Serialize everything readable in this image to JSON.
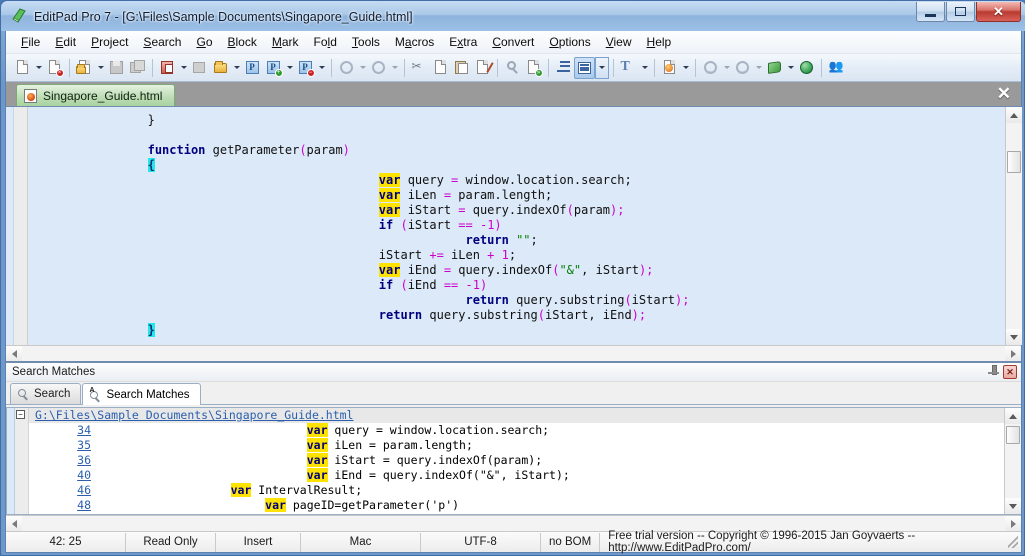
{
  "window": {
    "title": "EditPad Pro 7 - [G:\\Files\\Sample Documents\\Singapore_Guide.html]",
    "icon": "editpad-logo-icon",
    "minimize_label": "",
    "maximize_label": "",
    "close_label": "✕"
  },
  "menu": {
    "items": [
      {
        "label": "File",
        "accel": "F"
      },
      {
        "label": "Edit",
        "accel": "E"
      },
      {
        "label": "Project",
        "accel": "P"
      },
      {
        "label": "Search",
        "accel": "S"
      },
      {
        "label": "Go",
        "accel": "G"
      },
      {
        "label": "Block",
        "accel": "B"
      },
      {
        "label": "Mark",
        "accel": "M"
      },
      {
        "label": "Fold",
        "accel": "l"
      },
      {
        "label": "Tools",
        "accel": "T"
      },
      {
        "label": "Macros",
        "accel": "a"
      },
      {
        "label": "Extra",
        "accel": "x"
      },
      {
        "label": "Convert",
        "accel": "C"
      },
      {
        "label": "Options",
        "accel": "O"
      },
      {
        "label": "View",
        "accel": "V"
      },
      {
        "label": "Help",
        "accel": "H"
      }
    ]
  },
  "toolbar": {
    "buttons": [
      {
        "name": "new-file",
        "icon": "new-page-icon",
        "dropdown": true,
        "enabled": true
      },
      {
        "name": "close-file",
        "icon": "page-close-icon",
        "dropdown": false,
        "enabled": true
      },
      {
        "name": "open-file",
        "icon": "open-folder-icon",
        "dropdown": true,
        "enabled": true
      },
      {
        "name": "save-file",
        "icon": "floppy-save-icon",
        "dropdown": false,
        "enabled": false
      },
      {
        "name": "save-all",
        "icon": "save-all-icon",
        "dropdown": false,
        "enabled": false
      },
      {
        "name": "close-project",
        "icon": "project-close-icon",
        "dropdown": true,
        "enabled": true
      },
      {
        "name": "save-project",
        "icon": "project-save-icon",
        "dropdown": false,
        "enabled": false
      },
      {
        "name": "open-project",
        "icon": "project-folder-icon",
        "dropdown": true,
        "enabled": true
      },
      {
        "name": "project-p",
        "icon": "project-p-icon",
        "dropdown": false,
        "enabled": true
      },
      {
        "name": "project-add",
        "icon": "project-p-add-icon",
        "dropdown": true,
        "enabled": true
      },
      {
        "name": "project-remove",
        "icon": "project-p-remove-icon",
        "dropdown": true,
        "enabled": true
      },
      {
        "name": "undo",
        "icon": "undo-icon",
        "dropdown": true,
        "enabled": false
      },
      {
        "name": "redo",
        "icon": "redo-icon",
        "dropdown": true,
        "enabled": false
      },
      {
        "name": "cut",
        "icon": "scissors-icon",
        "dropdown": false,
        "enabled": true
      },
      {
        "name": "copy",
        "icon": "copy-icon",
        "dropdown": false,
        "enabled": true
      },
      {
        "name": "paste",
        "icon": "clipboard-paste-icon",
        "dropdown": false,
        "enabled": true
      },
      {
        "name": "edit-clipboard",
        "icon": "pencil-page-icon",
        "dropdown": false,
        "enabled": true
      },
      {
        "name": "find",
        "icon": "magnifier-icon",
        "dropdown": false,
        "enabled": false
      },
      {
        "name": "find-next",
        "icon": "page-find-icon",
        "dropdown": false,
        "enabled": true
      },
      {
        "name": "indent",
        "icon": "indent-icon",
        "dropdown": false,
        "enabled": true
      },
      {
        "name": "word-wrap",
        "icon": "word-wrap-icon",
        "dropdown": true,
        "enabled": true,
        "pressed": true
      },
      {
        "name": "font",
        "icon": "text-font-icon",
        "dropdown": true,
        "enabled": false
      },
      {
        "name": "preview-browser",
        "icon": "browser-page-icon",
        "dropdown": true,
        "enabled": true
      },
      {
        "name": "back",
        "icon": "back-arrow-icon",
        "dropdown": true,
        "enabled": false
      },
      {
        "name": "forward",
        "icon": "forward-arrow-icon",
        "dropdown": true,
        "enabled": false
      },
      {
        "name": "book",
        "icon": "green-book-icon",
        "dropdown": true,
        "enabled": true
      },
      {
        "name": "web",
        "icon": "globe-icon",
        "dropdown": false,
        "enabled": true
      },
      {
        "name": "users",
        "icon": "people-icon",
        "dropdown": false,
        "enabled": true
      }
    ]
  },
  "file_tabs": {
    "tabs": [
      {
        "label": "Singapore_Guide.html",
        "icon": "html-file-icon",
        "active": true
      }
    ],
    "close_label": "✕"
  },
  "editor": {
    "lines": [
      {
        "indent": 4,
        "tokens": [
          {
            "t": "}",
            "c": "plain"
          }
        ]
      },
      {
        "indent": 0,
        "tokens": []
      },
      {
        "indent": 4,
        "tokens": [
          {
            "t": "function",
            "c": "kw"
          },
          {
            "t": " getParameter",
            "c": "plain"
          },
          {
            "t": "(",
            "c": "op"
          },
          {
            "t": "param",
            "c": "plain"
          },
          {
            "t": ")",
            "c": "op"
          }
        ]
      },
      {
        "indent": 4,
        "tokens": [
          {
            "t": "{",
            "c": "brc-sel"
          }
        ]
      },
      {
        "indent": 12,
        "tokens": [
          {
            "t": "var",
            "c": "kwv"
          },
          {
            "t": " query ",
            "c": "plain"
          },
          {
            "t": "=",
            "c": "op"
          },
          {
            "t": " window.location.search;",
            "c": "plain"
          }
        ]
      },
      {
        "indent": 12,
        "tokens": [
          {
            "t": "var",
            "c": "kwv"
          },
          {
            "t": " iLen ",
            "c": "plain"
          },
          {
            "t": "=",
            "c": "op"
          },
          {
            "t": " param.length;",
            "c": "plain"
          }
        ]
      },
      {
        "indent": 12,
        "tokens": [
          {
            "t": "var",
            "c": "kwv"
          },
          {
            "t": " iStart ",
            "c": "plain"
          },
          {
            "t": "=",
            "c": "op"
          },
          {
            "t": " query.indexOf",
            "c": "plain"
          },
          {
            "t": "(",
            "c": "op"
          },
          {
            "t": "param",
            "c": "plain"
          },
          {
            "t": ");",
            "c": "op"
          }
        ]
      },
      {
        "indent": 12,
        "tokens": [
          {
            "t": "if",
            "c": "kw"
          },
          {
            "t": " ",
            "c": "plain"
          },
          {
            "t": "(",
            "c": "op"
          },
          {
            "t": "iStart ",
            "c": "plain"
          },
          {
            "t": "==",
            "c": "op"
          },
          {
            "t": " ",
            "c": "plain"
          },
          {
            "t": "-1",
            "c": "num"
          },
          {
            "t": ")",
            "c": "op"
          }
        ]
      },
      {
        "indent": 15,
        "tokens": [
          {
            "t": "return",
            "c": "kw"
          },
          {
            "t": " ",
            "c": "plain"
          },
          {
            "t": "\"\"",
            "c": "str"
          },
          {
            "t": ";",
            "c": "plain"
          }
        ]
      },
      {
        "indent": 12,
        "tokens": [
          {
            "t": "iStart ",
            "c": "plain"
          },
          {
            "t": "+=",
            "c": "op"
          },
          {
            "t": " iLen ",
            "c": "plain"
          },
          {
            "t": "+",
            "c": "op"
          },
          {
            "t": " ",
            "c": "plain"
          },
          {
            "t": "1",
            "c": "num"
          },
          {
            "t": ";",
            "c": "plain"
          }
        ]
      },
      {
        "indent": 12,
        "tokens": [
          {
            "t": "var",
            "c": "kwv"
          },
          {
            "t": " iEnd ",
            "c": "plain"
          },
          {
            "t": "=",
            "c": "op"
          },
          {
            "t": " query.indexOf",
            "c": "plain"
          },
          {
            "t": "(",
            "c": "op"
          },
          {
            "t": "\"&\"",
            "c": "str"
          },
          {
            "t": ", iStart",
            "c": "plain"
          },
          {
            "t": ");",
            "c": "op"
          }
        ]
      },
      {
        "indent": 12,
        "tokens": [
          {
            "t": "if",
            "c": "kw"
          },
          {
            "t": " ",
            "c": "plain"
          },
          {
            "t": "(",
            "c": "op"
          },
          {
            "t": "iEnd ",
            "c": "plain"
          },
          {
            "t": "==",
            "c": "op"
          },
          {
            "t": " ",
            "c": "plain"
          },
          {
            "t": "-1",
            "c": "num"
          },
          {
            "t": ")",
            "c": "op"
          }
        ]
      },
      {
        "indent": 15,
        "tokens": [
          {
            "t": "return",
            "c": "kw"
          },
          {
            "t": " query.substring",
            "c": "plain"
          },
          {
            "t": "(",
            "c": "op"
          },
          {
            "t": "iStart",
            "c": "plain"
          },
          {
            "t": ");",
            "c": "op"
          }
        ]
      },
      {
        "indent": 12,
        "tokens": [
          {
            "t": "return",
            "c": "kw"
          },
          {
            "t": " query.substring",
            "c": "plain"
          },
          {
            "t": "(",
            "c": "op"
          },
          {
            "t": "iStart, iEnd",
            "c": "plain"
          },
          {
            "t": ");",
            "c": "op"
          }
        ]
      },
      {
        "indent": 4,
        "tokens": [
          {
            "t": "}",
            "c": "brc-sel"
          }
        ]
      }
    ]
  },
  "panel": {
    "caption": "Search Matches",
    "pin_icon": "pin-icon",
    "close_icon": "close-icon",
    "close_label": "✕",
    "tabs": [
      {
        "label": "Search",
        "icon": "magnifier-icon",
        "active": false
      },
      {
        "label": "Search Matches",
        "icon": "magnifier-a-icon",
        "active": true
      }
    ],
    "results_header": "G:\\Files\\Sample Documents\\Singapore_Guide.html",
    "results": [
      {
        "line": "34",
        "pre": "                              ",
        "kw": "var",
        "post": " query = window.location.search;"
      },
      {
        "line": "35",
        "pre": "                              ",
        "kw": "var",
        "post": " iLen = param.length;"
      },
      {
        "line": "36",
        "pre": "                              ",
        "kw": "var",
        "post": " iStart = query.indexOf(param);"
      },
      {
        "line": "40",
        "pre": "                              ",
        "kw": "var",
        "post": " iEnd = query.indexOf(\"&\", iStart);"
      },
      {
        "line": "46",
        "pre": "                   ",
        "kw": "var",
        "post": " IntervalResult;"
      },
      {
        "line": "48",
        "pre": "                        ",
        "kw": "var",
        "post": " pageID=getParameter('p')"
      }
    ]
  },
  "statusbar": {
    "cells": [
      {
        "name": "caret-position",
        "value": "42: 25"
      },
      {
        "name": "read-only-mode",
        "value": "Read Only"
      },
      {
        "name": "insert-mode",
        "value": "Insert"
      },
      {
        "name": "line-break-type",
        "value": "Mac"
      },
      {
        "name": "encoding",
        "value": "UTF-8"
      },
      {
        "name": "byte-order-mark",
        "value": "no BOM"
      }
    ],
    "message": "Free trial version  --  Copyright © 1996-2015 Jan Goyvaerts  --  http://www.EditPadPro.com/"
  },
  "colors": {
    "keyword": "#00007f",
    "highlight": "#ffe300",
    "operator": "#cc00cc",
    "string": "#007f00",
    "selection": "#23e8e8",
    "editor_bg": "#dce9f9",
    "link": "#2b5fae"
  }
}
